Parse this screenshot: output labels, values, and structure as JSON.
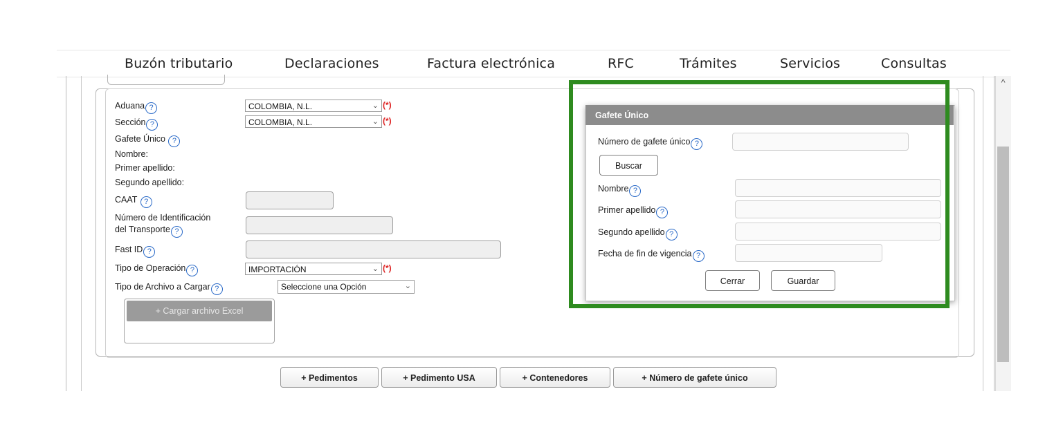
{
  "nav": {
    "items": [
      "Buzón tributario",
      "Declaraciones",
      "Factura electrónica",
      "RFC",
      "Trámites",
      "Servicios",
      "Consultas"
    ]
  },
  "form": {
    "aduana_label": "Aduana",
    "aduana_value": "COLOMBIA, N.L.",
    "seccion_label": "Sección",
    "seccion_value": "COLOMBIA, N.L.",
    "required_mark": "(*)",
    "gafete_label": "Gafete Único",
    "nombre_label": "Nombre:",
    "primer_apellido_label": "Primer apellido:",
    "segundo_apellido_label": "Segundo apellido:",
    "caat_label": "CAAT",
    "num_ident_label_1": "Número de Identificación",
    "num_ident_label_2": "del Transporte",
    "fast_id_label": "Fast ID",
    "tipo_operacion_label": "Tipo de Operación",
    "tipo_operacion_value": "IMPORTACIÓN",
    "tipo_archivo_label": "Tipo de Archivo a Cargar",
    "tipo_archivo_value": "Seleccione una Opción",
    "cargar_excel_label": "Cargar archivo Excel"
  },
  "bottom_buttons": [
    "+ Pedimentos",
    "+ Pedimento USA",
    "+ Contenedores",
    "+ Número de gafete único"
  ],
  "dialog": {
    "title": "Gafete Único",
    "numero_label": "Número de gafete único",
    "buscar_label": "Buscar",
    "nombre_label": "Nombre",
    "primer_apellido_label": "Primer apellido",
    "segundo_apellido_label": "Segundo apellido",
    "fecha_label": "Fecha de fin de vigencia",
    "cerrar_label": "Cerrar",
    "guardar_label": "Guardar"
  },
  "icons": {
    "help": "question-circle-icon",
    "chevron": "chevron-down-icon",
    "scroll_up": "chevron-up-icon",
    "plus": "plus-icon"
  },
  "colors": {
    "highlight": "#2e8b1f",
    "help_icon": "#2a6ac8",
    "required": "#d22222",
    "dialog_header": "#8c8c8c"
  }
}
